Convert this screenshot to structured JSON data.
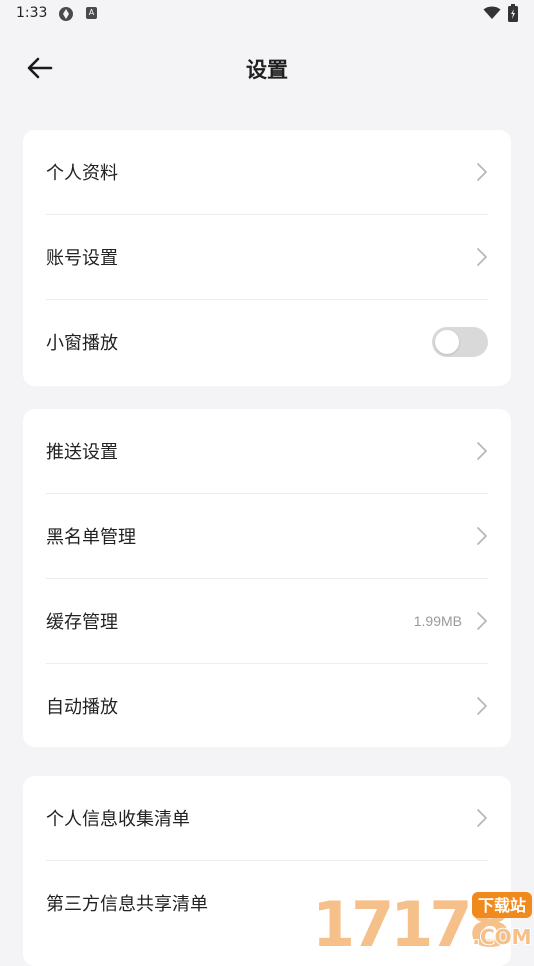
{
  "status_bar": {
    "time": "1:33",
    "notification_badge": "A"
  },
  "header": {
    "title": "设置",
    "back_icon": "arrow-left-icon"
  },
  "groups": [
    {
      "items": [
        {
          "label": "个人资料",
          "control": "chevron"
        },
        {
          "label": "账号设置",
          "control": "chevron"
        },
        {
          "label": "小窗播放",
          "control": "toggle",
          "toggle_on": false
        }
      ]
    },
    {
      "items": [
        {
          "label": "推送设置",
          "control": "chevron"
        },
        {
          "label": "黑名单管理",
          "control": "chevron"
        },
        {
          "label": "缓存管理",
          "value": "1.99MB",
          "control": "chevron"
        },
        {
          "label": "自动播放",
          "control": "chevron"
        }
      ]
    },
    {
      "items": [
        {
          "label": "个人信息收集清单",
          "control": "chevron"
        },
        {
          "label": "第三方信息共享清单",
          "control": "chevron"
        }
      ]
    }
  ],
  "watermark": {
    "number": "17178",
    "tag": "下载站",
    "domain": ".COM"
  },
  "colors": {
    "background": "#f4f4f6",
    "card": "#ffffff",
    "toggle_off": "#d9d9d9",
    "watermark_orange": "#f08a1c"
  }
}
